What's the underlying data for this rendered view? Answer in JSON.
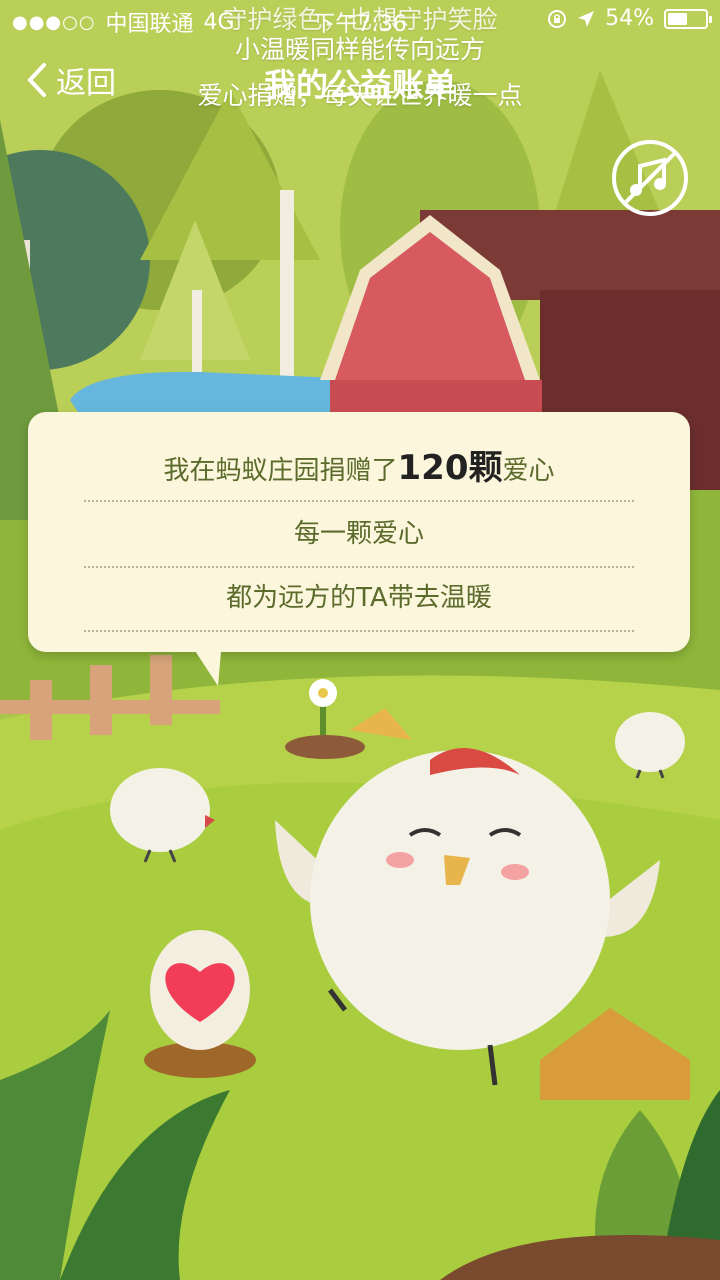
{
  "status_bar": {
    "signal": "●●●○○",
    "carrier": "中国联通",
    "network": "4G",
    "time": "下午7:36",
    "battery": "54%",
    "battery_level": 0.54
  },
  "captions": {
    "line_1": "守护绿色，也想守护笑脸",
    "line_2": "小温暖同样能传向远方",
    "line_3": "爱心捐赠，每天让世界暖一点"
  },
  "nav": {
    "back_label": "返回",
    "title": "我的公益账单"
  },
  "card": {
    "line_1_prefix": "我在蚂蚁庄园捐赠了",
    "line_1_amount": "120颗",
    "line_1_suffix": "爱心",
    "line_2": "每一颗爱心",
    "line_3": "都为远方的TA带去温暖"
  },
  "colors": {
    "background": "#a9c84a",
    "card": "#fbf6dc",
    "card_text": "#5b6b2b"
  }
}
